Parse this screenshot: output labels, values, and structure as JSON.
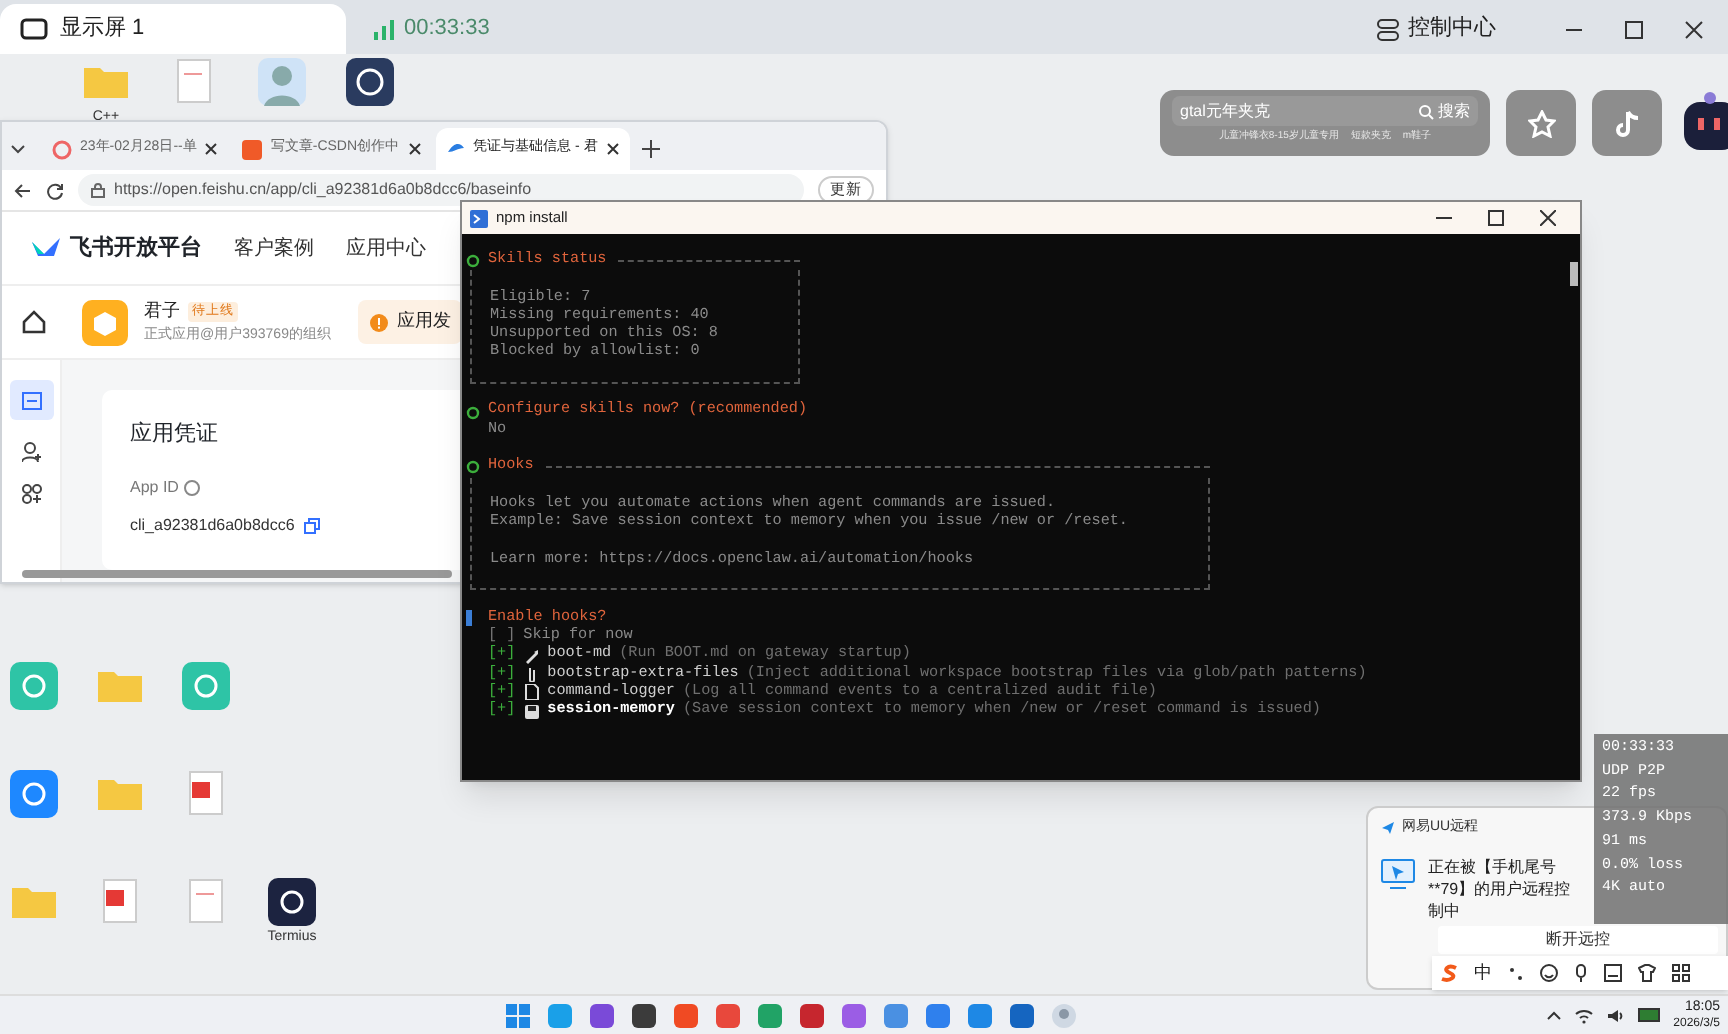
{
  "display_bar": {
    "tab": "显示屏 1",
    "timer": "00:33:33",
    "control_center": "控制中心"
  },
  "desktop_top_icons": [
    {
      "kind": "folder",
      "label": "C++"
    },
    {
      "kind": "document"
    },
    {
      "kind": "avatar"
    },
    {
      "kind": "app"
    }
  ],
  "desktop_grid_icons": [
    {
      "kind": "app"
    },
    {
      "kind": "folder"
    },
    {
      "kind": "app"
    },
    {
      "kind": "blank"
    },
    {
      "kind": "app"
    },
    {
      "kind": "folder"
    },
    {
      "kind": "pdf"
    },
    {
      "kind": "blank"
    },
    {
      "kind": "folder"
    },
    {
      "kind": "pdf"
    },
    {
      "kind": "document"
    },
    {
      "kind": "app",
      "label": "Termius"
    }
  ],
  "browser": {
    "tabs": [
      {
        "title": "23年-02月28日--单",
        "selected": false
      },
      {
        "title": "写文章-CSDN创作中",
        "selected": false
      },
      {
        "title": "凭证与基础信息 - 君",
        "selected": true
      }
    ],
    "url": "https://open.feishu.cn/app/cli_a92381d6a0b8dcc6/baseinfo",
    "update_button": "更新",
    "page": {
      "brand": "飞书开放平台",
      "nav": [
        "客户案例",
        "应用中心"
      ],
      "app_name": "君子",
      "app_status": "待上线",
      "app_org": "正式应用@用户393769的组织",
      "alert": "应用发",
      "card_title": "应用凭证",
      "field_label": "App ID",
      "field_value": "cli_a92381d6a0b8dcc6"
    }
  },
  "terminal": {
    "title": "npm install",
    "sections": [
      {
        "kind": "box",
        "title": "Skills status",
        "paragraphs": [
          [
            "Eligible: 7",
            "Missing requirements: 40",
            "Unsupported on this OS: 8",
            "Blocked by allowlist: 0"
          ]
        ]
      },
      {
        "kind": "prompt",
        "title": "Configure skills now? (recommended)",
        "answer": "No"
      },
      {
        "kind": "box",
        "title": "Hooks",
        "paragraphs": [
          [
            "Hooks let you automate actions when agent commands are issued.",
            "Example: Save session context to memory when you issue /new or /reset."
          ],
          [
            "Learn more: https://docs.openclaw.ai/automation/hooks"
          ]
        ]
      },
      {
        "kind": "multiselect",
        "title": "Enable hooks?",
        "options": [
          {
            "box": "[ ]",
            "name": "Skip for now",
            "checked": false,
            "selected": false
          },
          {
            "box": "[+]",
            "name": "boot-md",
            "description": "(Run BOOT.md on gateway startup)",
            "checked": true,
            "selected": false
          },
          {
            "box": "[+]",
            "name": "bootstrap-extra-files",
            "description": "(Inject additional workspace bootstrap files via glob/path patterns)",
            "checked": true,
            "selected": false
          },
          {
            "box": "[+]",
            "name": "command-logger",
            "description": "(Log all command events to a centralized audit file)",
            "checked": true,
            "selected": false
          },
          {
            "box": "[+]",
            "name": "session-memory",
            "description": "(Save session context to memory when /new or /reset command is issued)",
            "checked": true,
            "selected": true
          }
        ]
      }
    ]
  },
  "shopping_widget": {
    "query": "gtal元年夹克",
    "search_button": "搜索",
    "suggestions": [
      "儿童冲锋衣8-15岁儿童专用",
      "短款夹克",
      "m鞋子"
    ]
  },
  "stats_overlay": [
    "00:33:33",
    "UDP P2P",
    "22 fps",
    "373.9 Kbps",
    "91 ms",
    "0.0% loss",
    "4K auto"
  ],
  "notification": {
    "app": "网易UU远程",
    "message": "正在被【手机尾号**79】的用户远程控制中",
    "button": "断开远控"
  },
  "ime_bar": {
    "mode": "中"
  },
  "taskbar": {
    "time": "18:05",
    "date": "2026/3/5"
  }
}
